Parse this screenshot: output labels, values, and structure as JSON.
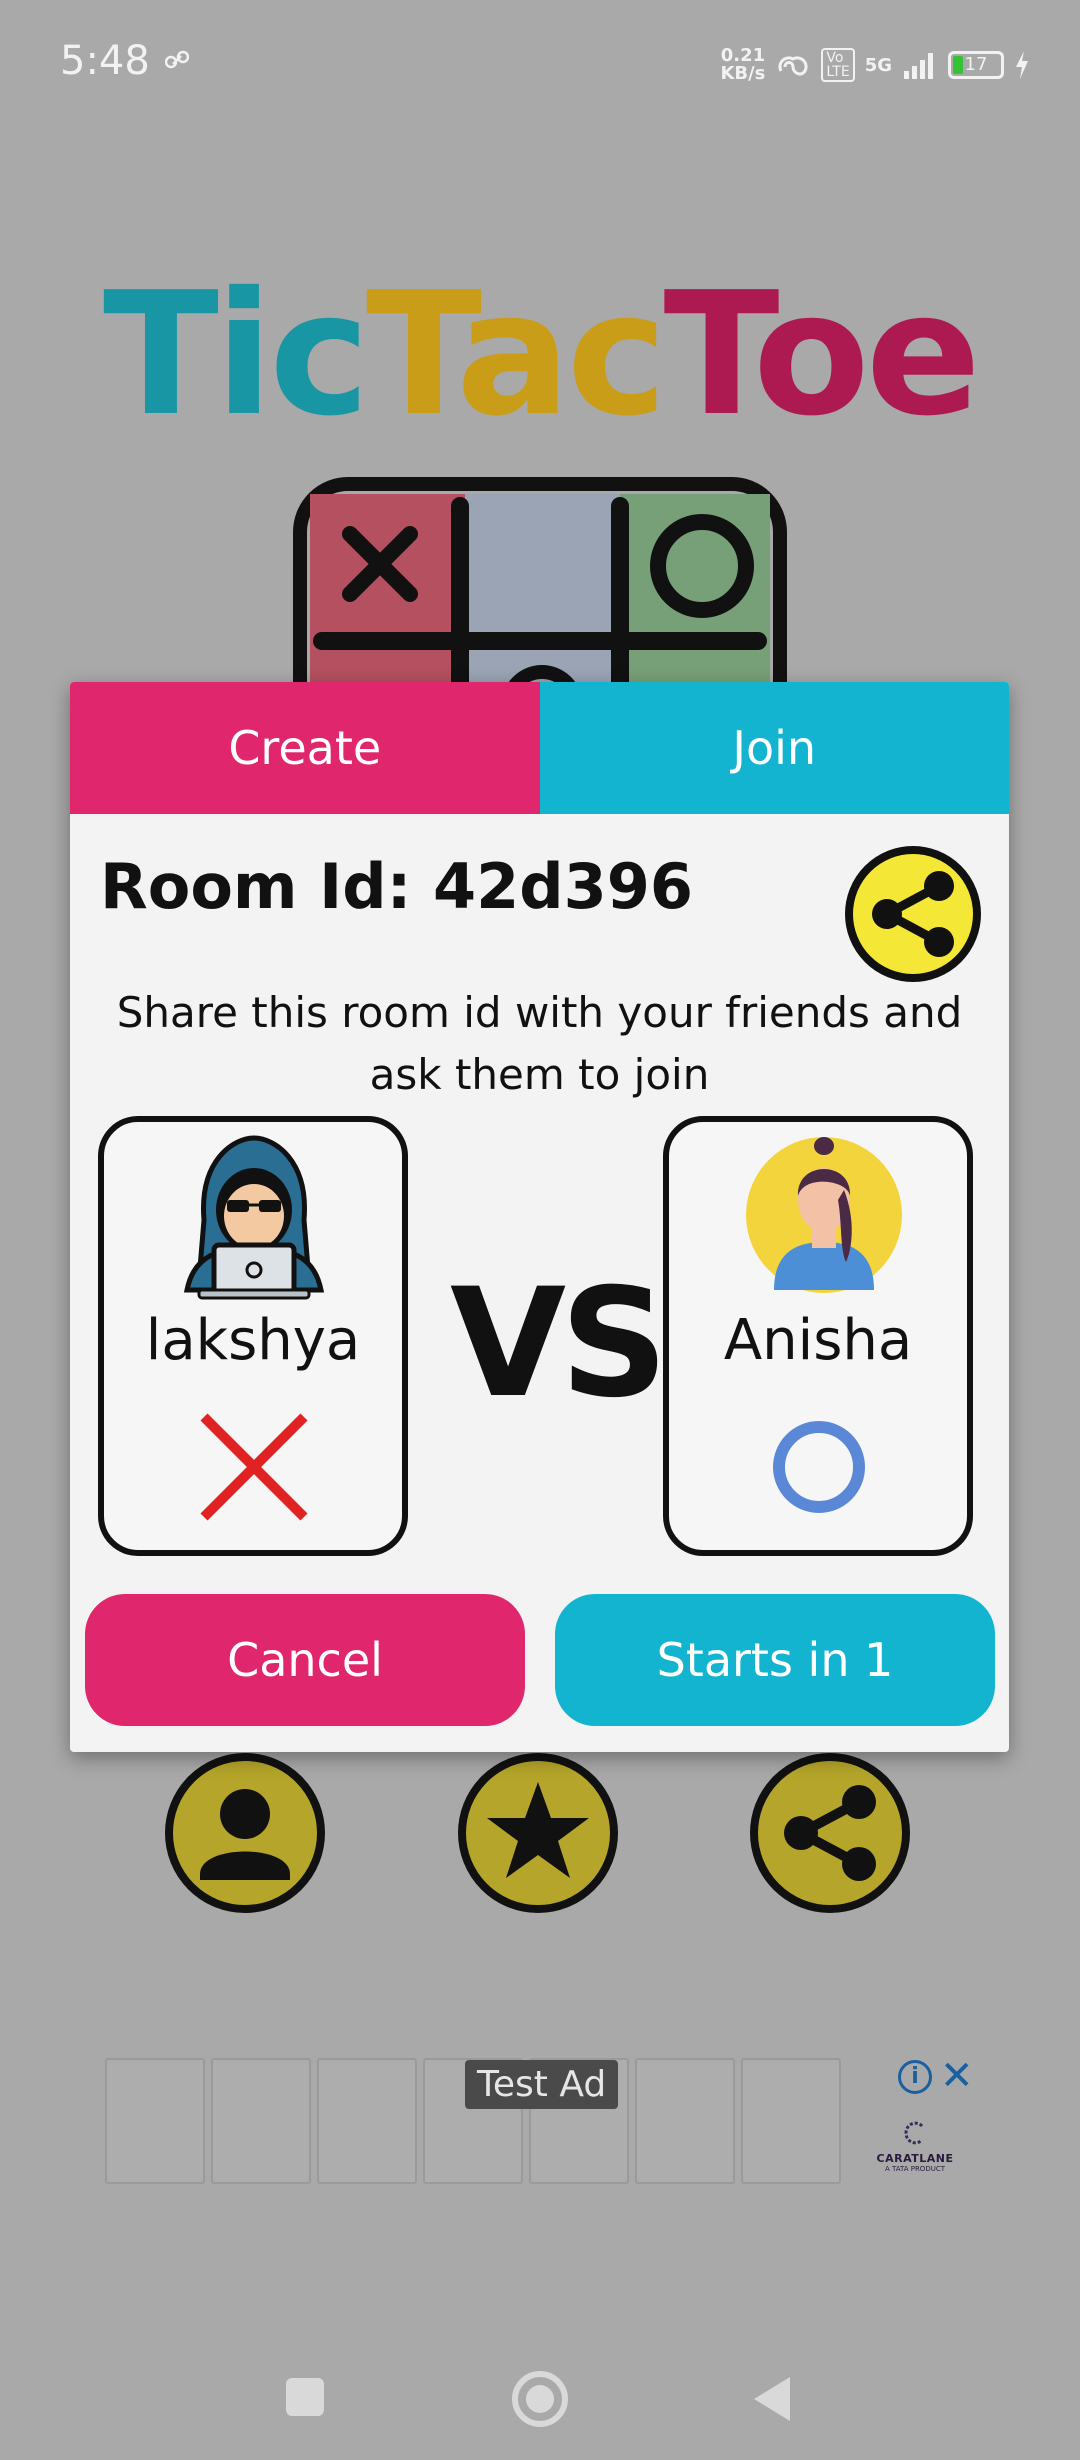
{
  "status_bar": {
    "time": "5:48",
    "net_speed_value": "0.21",
    "net_speed_unit": "KB/s",
    "volte_line1": "Vo",
    "volte_line2": "LTE",
    "network": "5G",
    "battery": "17"
  },
  "logo": {
    "part1": "Tic",
    "part2": "Tac",
    "part3": "Toe",
    "colors": {
      "tic": "#1896a3",
      "tac": "#c99d18",
      "toe": "#ad1a52"
    }
  },
  "dialog": {
    "tabs": [
      {
        "label": "Create",
        "active": true
      },
      {
        "label": "Join",
        "active": false
      }
    ],
    "room_id": "Room Id: 42d396",
    "share_message": "Share this room id with your friends and ask them to join",
    "vs": "VS",
    "player1": {
      "name": "lakshya",
      "mark": "X",
      "avatar": "hacker-avatar-icon"
    },
    "player2": {
      "name": "Anisha",
      "mark": "O",
      "avatar": "woman-avatar-icon"
    },
    "cancel_label": "Cancel",
    "start_label": "Starts in 1",
    "colors": {
      "primary_pink": "#e0276d",
      "primary_cyan": "#12b4d0",
      "share_yellow": "#f5e735"
    }
  },
  "home_buttons": [
    {
      "icon": "person-icon"
    },
    {
      "icon": "star-icon"
    },
    {
      "icon": "share-icon"
    }
  ],
  "ad": {
    "label": "Test Ad",
    "brand": "CARATLANE",
    "brand_sub": "A TATA PRODUCT",
    "info_glyph": "i",
    "close_glyph": "✕"
  }
}
